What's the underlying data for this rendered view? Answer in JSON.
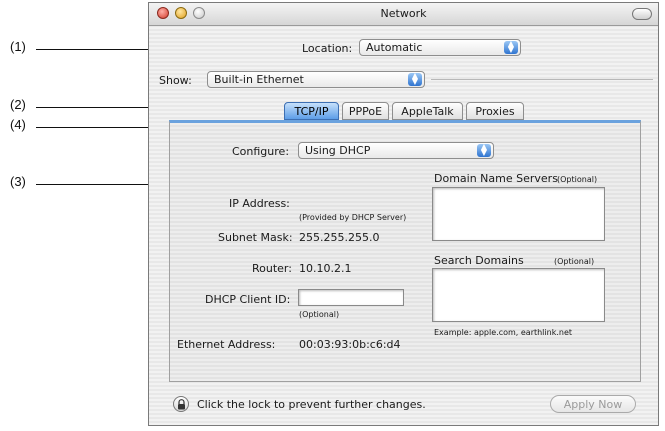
{
  "callouts": [
    "(1)",
    "(2)",
    "(4)",
    "(3)"
  ],
  "window": {
    "title": "Network"
  },
  "location": {
    "label": "Location:",
    "value": "Automatic"
  },
  "show": {
    "label": "Show:",
    "value": "Built-in Ethernet"
  },
  "tabs": [
    "TCP/IP",
    "PPPoE",
    "AppleTalk",
    "Proxies"
  ],
  "configure": {
    "label": "Configure:",
    "value": "Using DHCP"
  },
  "ip": {
    "label": "IP Address:",
    "note": "(Provided by DHCP Server)"
  },
  "subnet": {
    "label": "Subnet Mask:",
    "value": "255.255.255.0"
  },
  "router": {
    "label": "Router:",
    "value": "10.10.2.1"
  },
  "dhcp": {
    "label": "DHCP Client ID:",
    "note": "(Optional)"
  },
  "ethernet": {
    "label": "Ethernet Address:",
    "value": "00:03:93:0b:c6:d4"
  },
  "dns": {
    "label": "Domain Name Servers",
    "optional": "(Optional)"
  },
  "search": {
    "label": "Search Domains",
    "optional": "(Optional)",
    "example": "Example: apple.com, earthlink.net"
  },
  "footer": {
    "lock_text": "Click the lock to prevent further changes.",
    "apply_label": "Apply Now"
  }
}
